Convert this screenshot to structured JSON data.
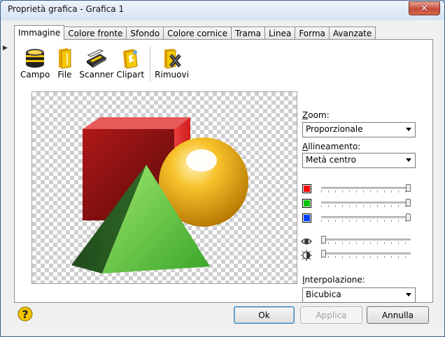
{
  "window": {
    "title": "Proprietà grafica - Grafica 1",
    "close_glyph": "✕"
  },
  "tabs": [
    {
      "label": "Immagine",
      "active": true
    },
    {
      "label": "Colore fronte"
    },
    {
      "label": "Sfondo"
    },
    {
      "label": "Colore cornice"
    },
    {
      "label": "Trama"
    },
    {
      "label": "Linea"
    },
    {
      "label": "Forma"
    },
    {
      "label": "Avanzate"
    }
  ],
  "toolbar": {
    "campo": {
      "label": "Campo",
      "icon": "database-icon"
    },
    "file": {
      "label": "File",
      "icon": "folder-icon"
    },
    "scanner": {
      "label": "Scanner",
      "icon": "scanner-icon"
    },
    "clipart": {
      "label": "Clipart",
      "icon": "clipart-icon"
    },
    "rimuovi": {
      "label": "Rimuovi",
      "icon": "remove-icon"
    }
  },
  "zoom": {
    "label_accel": "Z",
    "label_rest": "oom:",
    "value": "Proporzionale"
  },
  "alignment": {
    "label_accel": "A",
    "label_rest": "llineamento:",
    "value": "Metà centro"
  },
  "color_sliders": [
    {
      "color": "#ff0000",
      "value": 1.0
    },
    {
      "color": "#00c000",
      "value": 1.0
    },
    {
      "color": "#0040ff",
      "value": 1.0
    }
  ],
  "adjust_sliders": [
    {
      "icon": "eye-icon",
      "value": 0.0
    },
    {
      "icon": "contrast-icon",
      "value": 0.0
    }
  ],
  "interpolation": {
    "label_accel": "I",
    "label_rest": "nterpolazione:",
    "value": "Bicubica"
  },
  "buttons": {
    "ok": "Ok",
    "apply": "Applica",
    "cancel": "Annulla"
  }
}
